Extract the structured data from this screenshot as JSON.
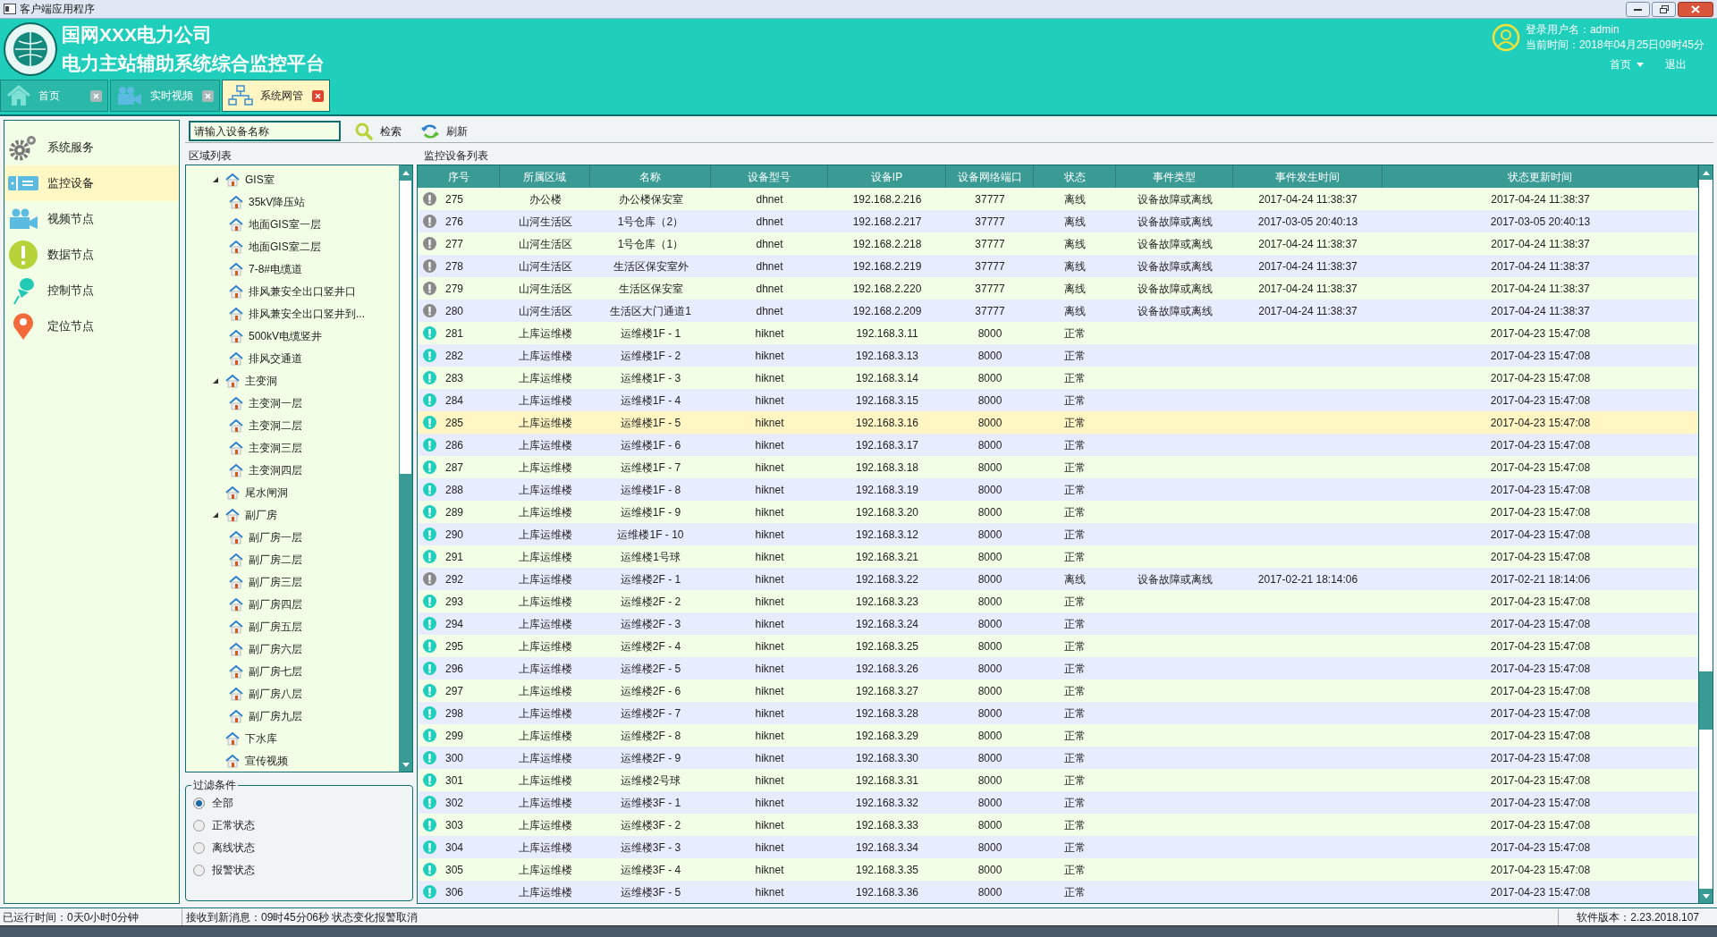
{
  "window": {
    "title": "客户端应用程序"
  },
  "header": {
    "company": "国网XXX电力公司",
    "platform": "电力主站辅助系统综合监控平台",
    "user_label": "登录用户名：admin",
    "time_label": "当前时间：2018年04月25日09时45分",
    "home_menu": "首页",
    "logout": "退出"
  },
  "tabs": [
    {
      "label": "首页",
      "selected": false
    },
    {
      "label": "实时视频",
      "selected": false
    },
    {
      "label": "系统网管",
      "selected": true
    }
  ],
  "sidebar": {
    "items": [
      {
        "label": "系统服务",
        "selected": false
      },
      {
        "label": "监控设备",
        "selected": true
      },
      {
        "label": "视频节点",
        "selected": false
      },
      {
        "label": "数据节点",
        "selected": false
      },
      {
        "label": "控制节点",
        "selected": false
      },
      {
        "label": "定位节点",
        "selected": false
      }
    ]
  },
  "toolbar": {
    "search": {
      "placeholder": "请输入设备名称"
    },
    "search_button": "检索",
    "refresh_button": "刷新"
  },
  "area_tree": {
    "title": "区域列表",
    "items": [
      {
        "label": "GIS室",
        "expanded": true,
        "children": [
          {
            "label": "35kV降压站"
          },
          {
            "label": "地面GIS室一层"
          },
          {
            "label": "地面GIS室二层"
          },
          {
            "label": "7-8#电缆道"
          },
          {
            "label": "排风兼安全出口竖井口"
          },
          {
            "label": "排风兼安全出口竖井到..."
          },
          {
            "label": "500kV电缆竖井"
          },
          {
            "label": "排风交通道"
          }
        ]
      },
      {
        "label": "主变洞",
        "expanded": true,
        "children": [
          {
            "label": "主变洞一层"
          },
          {
            "label": "主变洞二层"
          },
          {
            "label": "主变洞三层"
          },
          {
            "label": "主变洞四层"
          }
        ]
      },
      {
        "label": "尾水闸洞"
      },
      {
        "label": "副厂房",
        "expanded": true,
        "children": [
          {
            "label": "副厂房一层"
          },
          {
            "label": "副厂房二层"
          },
          {
            "label": "副厂房三层"
          },
          {
            "label": "副厂房四层"
          },
          {
            "label": "副厂房五层"
          },
          {
            "label": "副厂房六层"
          },
          {
            "label": "副厂房七层"
          },
          {
            "label": "副厂房八层"
          },
          {
            "label": "副厂房九层"
          }
        ]
      },
      {
        "label": "下水库"
      },
      {
        "label": "宣传视频"
      }
    ]
  },
  "filter": {
    "title": "过滤条件",
    "options": [
      {
        "label": "全部",
        "selected": true
      },
      {
        "label": "正常状态",
        "selected": false
      },
      {
        "label": "离线状态",
        "selected": false
      },
      {
        "label": "报警状态",
        "selected": false
      }
    ]
  },
  "table": {
    "title": "监控设备列表",
    "columns": [
      "序号",
      "所属区域",
      "名称",
      "设备型号",
      "设备IP",
      "设备网络端口",
      "状态",
      "事件类型",
      "事件发生时间",
      "状态更新时间"
    ],
    "rows": [
      {
        "kind": "offline",
        "selected": false,
        "cells": [
          "275",
          "办公楼",
          "办公楼保安室",
          "dhnet",
          "192.168.2.216",
          "37777",
          "离线",
          "设备故障或离线",
          "2017-04-24 11:38:37",
          "2017-04-24 11:38:37"
        ]
      },
      {
        "kind": "offline",
        "selected": false,
        "cells": [
          "276",
          "山河生活区",
          "1号仓库（2）",
          "dhnet",
          "192.168.2.217",
          "37777",
          "离线",
          "设备故障或离线",
          "2017-03-05 20:40:13",
          "2017-03-05 20:40:13"
        ]
      },
      {
        "kind": "offline",
        "selected": false,
        "cells": [
          "277",
          "山河生活区",
          "1号仓库（1）",
          "dhnet",
          "192.168.2.218",
          "37777",
          "离线",
          "设备故障或离线",
          "2017-04-24 11:38:37",
          "2017-04-24 11:38:37"
        ]
      },
      {
        "kind": "offline",
        "selected": false,
        "cells": [
          "278",
          "山河生活区",
          "生活区保安室外",
          "dhnet",
          "192.168.2.219",
          "37777",
          "离线",
          "设备故障或离线",
          "2017-04-24 11:38:37",
          "2017-04-24 11:38:37"
        ]
      },
      {
        "kind": "offline",
        "selected": false,
        "cells": [
          "279",
          "山河生活区",
          "生活区保安室",
          "dhnet",
          "192.168.2.220",
          "37777",
          "离线",
          "设备故障或离线",
          "2017-04-24 11:38:37",
          "2017-04-24 11:38:37"
        ]
      },
      {
        "kind": "offline",
        "selected": false,
        "cells": [
          "280",
          "山河生活区",
          "生活区大门通道1",
          "dhnet",
          "192.168.2.209",
          "37777",
          "离线",
          "设备故障或离线",
          "2017-04-24 11:38:37",
          "2017-04-24 11:38:37"
        ]
      },
      {
        "kind": "normal",
        "selected": false,
        "cells": [
          "281",
          "上库运维楼",
          "运维楼1F - 1",
          "hiknet",
          "192.168.3.11",
          "8000",
          "正常",
          null,
          null,
          "2017-04-23 15:47:08"
        ]
      },
      {
        "kind": "normal",
        "selected": false,
        "cells": [
          "282",
          "上库运维楼",
          "运维楼1F - 2",
          "hiknet",
          "192.168.3.13",
          "8000",
          "正常",
          null,
          null,
          "2017-04-23 15:47:08"
        ]
      },
      {
        "kind": "normal",
        "selected": false,
        "cells": [
          "283",
          "上库运维楼",
          "运维楼1F - 3",
          "hiknet",
          "192.168.3.14",
          "8000",
          "正常",
          null,
          null,
          "2017-04-23 15:47:08"
        ]
      },
      {
        "kind": "normal",
        "selected": false,
        "cells": [
          "284",
          "上库运维楼",
          "运维楼1F - 4",
          "hiknet",
          "192.168.3.15",
          "8000",
          "正常",
          null,
          null,
          "2017-04-23 15:47:08"
        ]
      },
      {
        "kind": "normal",
        "selected": true,
        "cells": [
          "285",
          "上库运维楼",
          "运维楼1F - 5",
          "hiknet",
          "192.168.3.16",
          "8000",
          "正常",
          null,
          null,
          "2017-04-23 15:47:08"
        ]
      },
      {
        "kind": "normal",
        "selected": false,
        "cells": [
          "286",
          "上库运维楼",
          "运维楼1F - 6",
          "hiknet",
          "192.168.3.17",
          "8000",
          "正常",
          null,
          null,
          "2017-04-23 15:47:08"
        ]
      },
      {
        "kind": "normal",
        "selected": false,
        "cells": [
          "287",
          "上库运维楼",
          "运维楼1F - 7",
          "hiknet",
          "192.168.3.18",
          "8000",
          "正常",
          null,
          null,
          "2017-04-23 15:47:08"
        ]
      },
      {
        "kind": "normal",
        "selected": false,
        "cells": [
          "288",
          "上库运维楼",
          "运维楼1F - 8",
          "hiknet",
          "192.168.3.19",
          "8000",
          "正常",
          null,
          null,
          "2017-04-23 15:47:08"
        ]
      },
      {
        "kind": "normal",
        "selected": false,
        "cells": [
          "289",
          "上库运维楼",
          "运维楼1F - 9",
          "hiknet",
          "192.168.3.20",
          "8000",
          "正常",
          null,
          null,
          "2017-04-23 15:47:08"
        ]
      },
      {
        "kind": "normal",
        "selected": false,
        "cells": [
          "290",
          "上库运维楼",
          "运维楼1F - 10",
          "hiknet",
          "192.168.3.12",
          "8000",
          "正常",
          null,
          null,
          "2017-04-23 15:47:08"
        ]
      },
      {
        "kind": "normal",
        "selected": false,
        "cells": [
          "291",
          "上库运维楼",
          "运维楼1号球",
          "hiknet",
          "192.168.3.21",
          "8000",
          "正常",
          null,
          null,
          "2017-04-23 15:47:08"
        ]
      },
      {
        "kind": "offline",
        "selected": false,
        "cells": [
          "292",
          "上库运维楼",
          "运维楼2F - 1",
          "hiknet",
          "192.168.3.22",
          "8000",
          "离线",
          "设备故障或离线",
          "2017-02-21 18:14:06",
          "2017-02-21 18:14:06"
        ]
      },
      {
        "kind": "normal",
        "selected": false,
        "cells": [
          "293",
          "上库运维楼",
          "运维楼2F - 2",
          "hiknet",
          "192.168.3.23",
          "8000",
          "正常",
          null,
          null,
          "2017-04-23 15:47:08"
        ]
      },
      {
        "kind": "normal",
        "selected": false,
        "cells": [
          "294",
          "上库运维楼",
          "运维楼2F - 3",
          "hiknet",
          "192.168.3.24",
          "8000",
          "正常",
          null,
          null,
          "2017-04-23 15:47:08"
        ]
      },
      {
        "kind": "normal",
        "selected": false,
        "cells": [
          "295",
          "上库运维楼",
          "运维楼2F - 4",
          "hiknet",
          "192.168.3.25",
          "8000",
          "正常",
          null,
          null,
          "2017-04-23 15:47:08"
        ]
      },
      {
        "kind": "normal",
        "selected": false,
        "cells": [
          "296",
          "上库运维楼",
          "运维楼2F - 5",
          "hiknet",
          "192.168.3.26",
          "8000",
          "正常",
          null,
          null,
          "2017-04-23 15:47:08"
        ]
      },
      {
        "kind": "normal",
        "selected": false,
        "cells": [
          "297",
          "上库运维楼",
          "运维楼2F - 6",
          "hiknet",
          "192.168.3.27",
          "8000",
          "正常",
          null,
          null,
          "2017-04-23 15:47:08"
        ]
      },
      {
        "kind": "normal",
        "selected": false,
        "cells": [
          "298",
          "上库运维楼",
          "运维楼2F - 7",
          "hiknet",
          "192.168.3.28",
          "8000",
          "正常",
          null,
          null,
          "2017-04-23 15:47:08"
        ]
      },
      {
        "kind": "normal",
        "selected": false,
        "cells": [
          "299",
          "上库运维楼",
          "运维楼2F - 8",
          "hiknet",
          "192.168.3.29",
          "8000",
          "正常",
          null,
          null,
          "2017-04-23 15:47:08"
        ]
      },
      {
        "kind": "normal",
        "selected": false,
        "cells": [
          "300",
          "上库运维楼",
          "运维楼2F - 9",
          "hiknet",
          "192.168.3.30",
          "8000",
          "正常",
          null,
          null,
          "2017-04-23 15:47:08"
        ]
      },
      {
        "kind": "normal",
        "selected": false,
        "cells": [
          "301",
          "上库运维楼",
          "运维楼2号球",
          "hiknet",
          "192.168.3.31",
          "8000",
          "正常",
          null,
          null,
          "2017-04-23 15:47:08"
        ]
      },
      {
        "kind": "normal",
        "selected": false,
        "cells": [
          "302",
          "上库运维楼",
          "运维楼3F - 1",
          "hiknet",
          "192.168.3.32",
          "8000",
          "正常",
          null,
          null,
          "2017-04-23 15:47:08"
        ]
      },
      {
        "kind": "normal",
        "selected": false,
        "cells": [
          "303",
          "上库运维楼",
          "运维楼3F - 2",
          "hiknet",
          "192.168.3.33",
          "8000",
          "正常",
          null,
          null,
          "2017-04-23 15:47:08"
        ]
      },
      {
        "kind": "normal",
        "selected": false,
        "cells": [
          "304",
          "上库运维楼",
          "运维楼3F - 3",
          "hiknet",
          "192.168.3.34",
          "8000",
          "正常",
          null,
          null,
          "2017-04-23 15:47:08"
        ]
      },
      {
        "kind": "normal",
        "selected": false,
        "cells": [
          "305",
          "上库运维楼",
          "运维楼3F - 4",
          "hiknet",
          "192.168.3.35",
          "8000",
          "正常",
          null,
          null,
          "2017-04-23 15:47:08"
        ]
      },
      {
        "kind": "normal",
        "selected": false,
        "cells": [
          "306",
          "上库运维楼",
          "运维楼3F - 5",
          "hiknet",
          "192.168.3.36",
          "8000",
          "正常",
          null,
          null,
          "2017-04-23 15:47:08"
        ]
      }
    ]
  },
  "status_bar": {
    "uptime": "已运行时间：0天0小时0分钟",
    "message": "接收到新消息：09时45分06秒 状态变化报警取消",
    "version": "软件版本：2.23.2018.107"
  }
}
